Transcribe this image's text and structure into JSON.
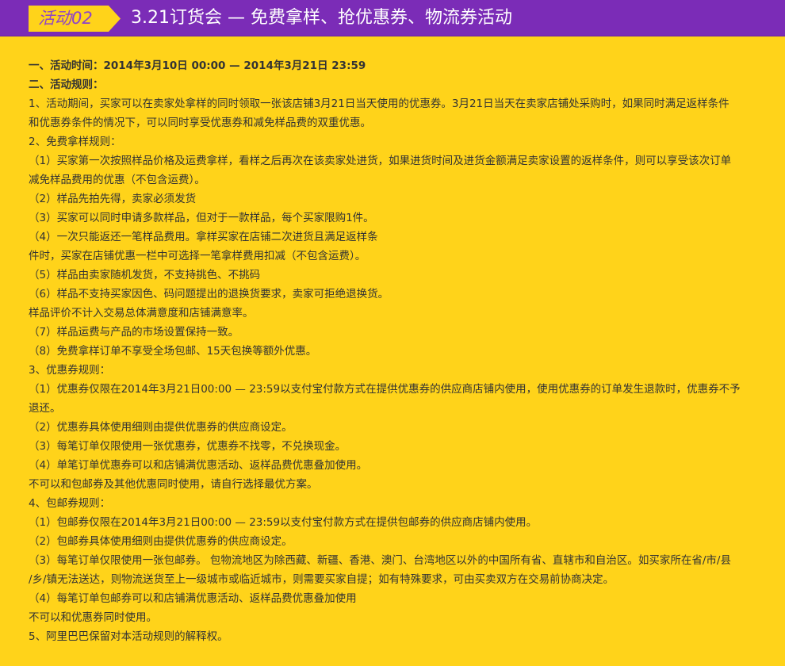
{
  "colors": {
    "header_bg": "#7b2cb7",
    "page_bg": "#ffd31a",
    "badge_bg": "#ffd31a",
    "badge_text": "#8e43c9",
    "title_text": "#ffffff",
    "body_text": "#333333"
  },
  "header": {
    "badge": "活动02",
    "title": "3.21订货会 — 免费拿样、抢优惠券、物流券活动"
  },
  "content": {
    "activity_time": "一、活动时间：2014年3月10日 00:00 — 2014年3月21日 23:59",
    "rules_heading": "二、活动规则：",
    "general": {
      "lines": [
        "1、活动期间，买家可以在卖家处拿样的同时领取一张该店铺3月21日当天使用的优惠券。3月21日当天在卖家店铺处采购时，如果同时满足返样条件",
        "和优惠券条件的情况下，可以同时享受优惠券和减免样品费的双重优惠。"
      ]
    },
    "free_sample": {
      "heading": "2、免费拿样规则：",
      "items": [
        [
          "（1）买家第一次按照样品价格及运费拿样，看样之后再次在该卖家处进货，如果进货时间及进货金额满足卖家设置的返样条件，则可以享受该次订单",
          "减免样品费用的优惠（不包含运费）。"
        ],
        [
          "（2）样品先拍先得，卖家必须发货"
        ],
        [
          "（3）买家可以同时申请多款样品，但对于一款样品，每个买家限购1件。"
        ],
        [
          "（4）一次只能返还一笔样品费用。拿样买家在店铺二次进货且满足返样条",
          "件时，买家在店铺优惠一栏中可选择一笔拿样费用扣减（不包含运费）。"
        ],
        [
          "（5）样品由卖家随机发货，不支持挑色、不挑码"
        ],
        [
          "（6）样品不支持买家因色、码问题提出的退换货要求，卖家可拒绝退换货。",
          "样品评价不计入交易总体满意度和店铺满意率。"
        ],
        [
          "（7）样品运费与产品的市场设置保持一致。"
        ],
        [
          "（8）免费拿样订单不享受全场包邮、15天包换等额外优惠。"
        ]
      ]
    },
    "coupon": {
      "heading": "3、优惠券规则：",
      "items": [
        [
          "（1）优惠券仅限在2014年3月21日00:00 — 23:59以支付宝付款方式在提供优惠券的供应商店铺内使用，使用优惠券的订单发生退款时，优惠券不予",
          "退还。"
        ],
        [
          "（2）优惠券具体使用细则由提供优惠券的供应商设定。"
        ],
        [
          "（3）每笔订单仅限使用一张优惠券，优惠券不找零，不兑换现金。"
        ],
        [
          "（4）单笔订单优惠券可以和店铺满优惠活动、返样品费优惠叠加使用。",
          "不可以和包邮券及其他优惠同时使用，请自行选择最优方案。"
        ]
      ]
    },
    "shipping": {
      "heading": "4、包邮券规则：",
      "items": [
        [
          "（1）包邮券仅限在2014年3月21日00:00 — 23:59以支付宝付款方式在提供包邮券的供应商店铺内使用。"
        ],
        [
          "（2）包邮券具体使用细则由提供优惠券的供应商设定。"
        ],
        [
          "（3）每笔订单仅限使用一张包邮券。 包物流地区为除西藏、新疆、香港、澳门、台湾地区以外的中国所有省、直辖市和自治区。如买家所在省/市/县",
          "/乡/镇无法送达，则物流送货至上一级城市或临近城市，则需要买家自提；如有特殊要求，可由买卖双方在交易前协商决定。"
        ],
        [
          "（4）每笔订单包邮券可以和店铺满优惠活动、返样品费优惠叠加使用",
          "不可以和优惠券同时使用。"
        ]
      ]
    },
    "disclaimer": "5、阿里巴巴保留对本活动规则的解释权。"
  }
}
